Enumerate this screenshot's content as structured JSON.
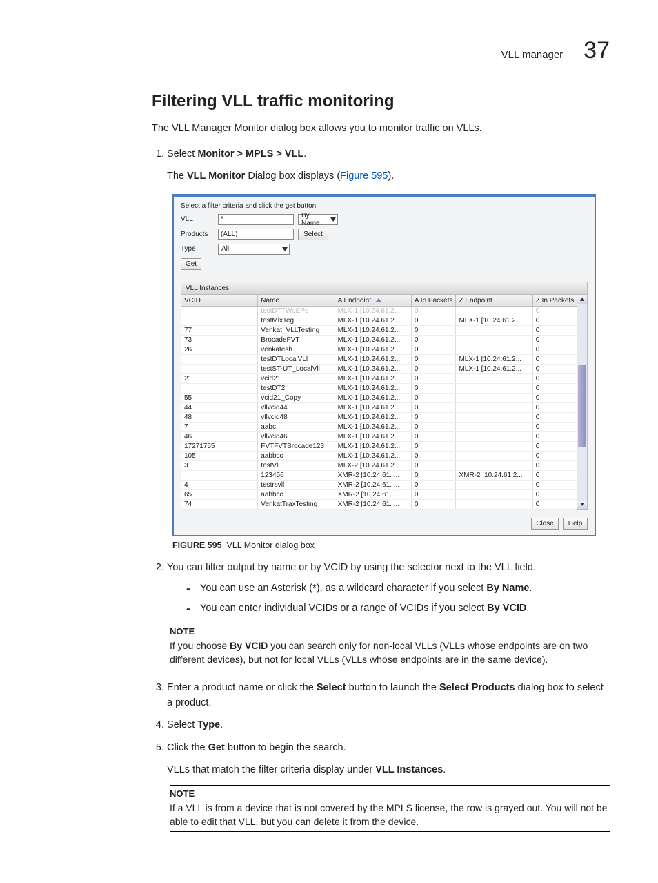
{
  "header": {
    "title": "VLL manager",
    "page_number": "37"
  },
  "page_heading": "Filtering VLL traffic monitoring",
  "intro": "The VLL Manager Monitor dialog box allows you to monitor traffic on VLLs.",
  "step1_pre": "Select ",
  "step1_bold": "Monitor > MPLS > VLL",
  "step1_post": ".",
  "step1_sub_pre": "The ",
  "step1_sub_bold": "VLL Monitor",
  "step1_sub_mid": " Dialog box displays (",
  "step1_sub_link": "Figure 595",
  "step1_sub_post": ").",
  "figure_label": "FIGURE 595",
  "figure_caption": "VLL Monitor dialog box",
  "step2": "You can filter output by name or by VCID by using the selector next to the VLL field.",
  "step2_dash1_pre": "You can use an Asterisk (*), as a wildcard character if you select ",
  "step2_dash1_bold": "By Name",
  "step2_dash1_post": ".",
  "step2_dash2_pre": "You can enter individual VCIDs or a range of VCIDs if you select ",
  "step2_dash2_bold": "By VCID",
  "step2_dash2_post": ".",
  "note1_label": "NOTE",
  "note1_pre": "If you choose ",
  "note1_bold": "By VCID",
  "note1_post": " you can search only for non-local VLLs (VLLs whose endpoints are on two different devices), but not for local VLLs (VLLs whose endpoints are in the same device).",
  "step3_pre": "Enter a product name or click the ",
  "step3_bold1": "Select",
  "step3_mid": " button to launch the ",
  "step3_bold2": "Select Products",
  "step3_post": " dialog box to select a product.",
  "step4_pre": "Select ",
  "step4_bold": "Type",
  "step4_post": ".",
  "step5_pre": "Click the ",
  "step5_bold": "Get",
  "step5_post": " button to begin the search.",
  "step5_sub_pre": "VLLs that match the filter criteria display under ",
  "step5_sub_bold": "VLL Instances",
  "step5_sub_post": ".",
  "note2_label": "NOTE",
  "note2_body": "If a VLL is from a device that is not covered by the MPLS license, the row is grayed out. You will not be able to edit that VLL, but you can delete it from the device.",
  "dlg": {
    "caption": "Select a filter criteria and click the get button",
    "vll_label": "VLL",
    "vll_value": "*",
    "byname": "By Name",
    "products_label": "Products",
    "products_value": "(ALL)",
    "select_btn": "Select",
    "type_label": "Type",
    "type_value": "All",
    "get_btn": "Get",
    "section": "VLL Instances",
    "cols": {
      "vcid": "VCID",
      "name": "Name",
      "aep": "A Endpoint",
      "ain": "A In Packets",
      "zep": "Z Endpoint",
      "zin": "Z In Packets"
    },
    "rows": [
      {
        "vcid": "",
        "name": "testDTTWoEPs",
        "aep": "MLX-1 [10.24.61.2...",
        "ain": "0",
        "zep": "",
        "zin": "0",
        "ghost": true
      },
      {
        "vcid": "",
        "name": "testMixTeg",
        "aep": "MLX-1 [10.24.61.2...",
        "ain": "0",
        "zep": "MLX-1 [10.24.61.2...",
        "zin": "0"
      },
      {
        "vcid": "77",
        "name": "Venkat_VLLTesting",
        "aep": "MLX-1 [10.24.61.2...",
        "ain": "0",
        "zep": "",
        "zin": "0"
      },
      {
        "vcid": "73",
        "name": "BrocadeFVT",
        "aep": "MLX-1 [10.24.61.2...",
        "ain": "0",
        "zep": "",
        "zin": "0"
      },
      {
        "vcid": "26",
        "name": "venkatesh",
        "aep": "MLX-1 [10.24.61.2...",
        "ain": "0",
        "zep": "",
        "zin": "0"
      },
      {
        "vcid": "",
        "name": "testDTLocalVLl",
        "aep": "MLX-1 [10.24.61.2...",
        "ain": "0",
        "zep": "MLX-1 [10.24.61.2...",
        "zin": "0"
      },
      {
        "vcid": "",
        "name": "testST-UT_LocalVll",
        "aep": "MLX-1 [10.24.61.2...",
        "ain": "0",
        "zep": "MLX-1 [10.24.61.2...",
        "zin": "0"
      },
      {
        "vcid": "21",
        "name": "vcid21",
        "aep": "MLX-1 [10.24.61.2...",
        "ain": "0",
        "zep": "",
        "zin": "0"
      },
      {
        "vcid": "",
        "name": "testDT2",
        "aep": "MLX-1 [10.24.61.2...",
        "ain": "0",
        "zep": "",
        "zin": "0"
      },
      {
        "vcid": "55",
        "name": "vcid21_Copy",
        "aep": "MLX-1 [10.24.61.2...",
        "ain": "0",
        "zep": "",
        "zin": "0"
      },
      {
        "vcid": "44",
        "name": "vllvcid44",
        "aep": "MLX-1 [10.24.61.2...",
        "ain": "0",
        "zep": "",
        "zin": "0"
      },
      {
        "vcid": "48",
        "name": "vllvcid48",
        "aep": "MLX-1 [10.24.61.2...",
        "ain": "0",
        "zep": "",
        "zin": "0"
      },
      {
        "vcid": "7",
        "name": "aabc",
        "aep": "MLX-1 [10.24.61.2...",
        "ain": "0",
        "zep": "",
        "zin": "0"
      },
      {
        "vcid": "46",
        "name": "vllvcid46",
        "aep": "MLX-1 [10.24.61.2...",
        "ain": "0",
        "zep": "",
        "zin": "0"
      },
      {
        "vcid": "17271755",
        "name": "FVTFVTBrocade123",
        "aep": "MLX-1 [10.24.61.2...",
        "ain": "0",
        "zep": "",
        "zin": "0"
      },
      {
        "vcid": "105",
        "name": "aabbcc",
        "aep": "MLX-1 [10.24.61.2...",
        "ain": "0",
        "zep": "",
        "zin": "0"
      },
      {
        "vcid": "3",
        "name": "testVll",
        "aep": "MLX-2 [10.24.61.2...",
        "ain": "0",
        "zep": "",
        "zin": "0"
      },
      {
        "vcid": "",
        "name": "123456",
        "aep": "XMR-2 [10.24.61. ...",
        "ain": "0",
        "zep": "XMR-2 [10.24.61.2...",
        "zin": "0"
      },
      {
        "vcid": "4",
        "name": "testrsvll",
        "aep": "XMR-2 [10.24.61. ...",
        "ain": "0",
        "zep": "",
        "zin": "0"
      },
      {
        "vcid": "65",
        "name": "aabbcc",
        "aep": "XMR-2 [10.24.61. ...",
        "ain": "0",
        "zep": "",
        "zin": "0"
      },
      {
        "vcid": "74",
        "name": "VenkatTraxTesting",
        "aep": "XMR-2 [10.24.61. ...",
        "ain": "0",
        "zep": "",
        "zin": "0"
      }
    ],
    "close_btn": "Close",
    "help_btn": "Help"
  }
}
